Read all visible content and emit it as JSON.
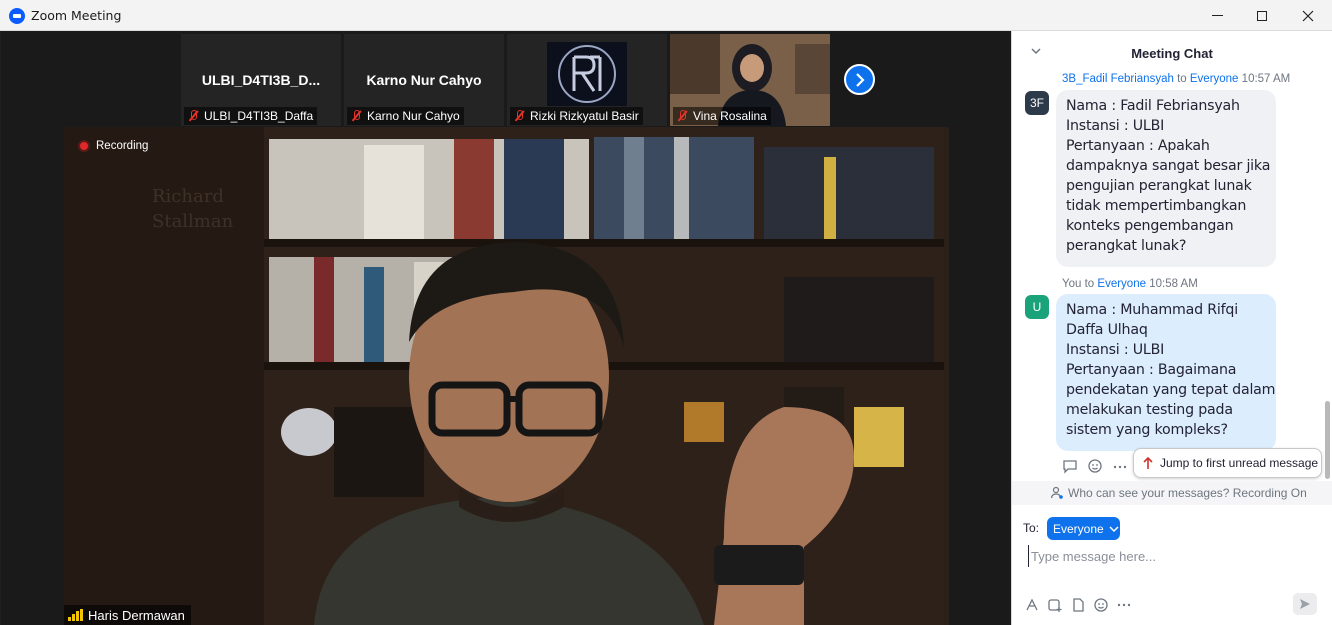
{
  "window": {
    "title": "Zoom Meeting",
    "controls": [
      "minimize",
      "maximize",
      "close"
    ]
  },
  "gallery": {
    "thumbnails": [
      {
        "display_name": "ULBI_D4TI3B_D...",
        "label": "ULBI_D4TI3B_Daffa",
        "muted": true,
        "video": false
      },
      {
        "display_name": "Karno Nur Cahyo",
        "label": "Karno Nur Cahyo",
        "muted": true,
        "video": false
      },
      {
        "display_name": "",
        "label": "Rizki Rizkyatul Basir",
        "muted": true,
        "video": false
      },
      {
        "display_name": "",
        "label": "Vina Rosalina",
        "muted": true,
        "video": true
      }
    ],
    "next_icon": "chevron-right-icon"
  },
  "main_video": {
    "recording_label": "Recording",
    "speaker_label": "Haris Dermawan",
    "background_text_1": "Richard",
    "background_text_2": "Stallman"
  },
  "chat": {
    "title": "Meeting Chat",
    "messages": [
      {
        "sender": "3B_Fadil Febriansyah",
        "to_word": "to",
        "recipient": "Everyone",
        "time": "10:57 AM",
        "avatar_initials": "3F",
        "avatar_color": "#2d3a4a",
        "lines": [
          "Nama : Fadil Febriansyah",
          "Instansi : ULBI",
          "Pertanyaan : Apakah",
          "dampaknya sangat besar jika",
          "pengujian perangkat lunak",
          "tidak mempertimbangkan",
          "konteks pengembangan",
          "perangkat lunak?"
        ]
      },
      {
        "sender": "You",
        "to_word": "to",
        "recipient": "Everyone",
        "time": "10:58 AM",
        "avatar_initials": "U",
        "avatar_color": "#1aa37a",
        "lines": [
          "Nama : Muhammad Rifqi",
          "Daffa Ulhaq",
          "Instansi : ULBI",
          "Pertanyaan : Bagaimana",
          "pendekatan yang tepat dalam",
          "melakukan testing pada",
          "sistem yang kompleks?"
        ]
      }
    ],
    "jump_label": "Jump to first unread message",
    "privacy_text": "Who can see your messages? Recording On",
    "to_label": "To:",
    "recipient_button": "Everyone",
    "input_placeholder": "Type message here...",
    "accent_color": "#0e72ed"
  }
}
